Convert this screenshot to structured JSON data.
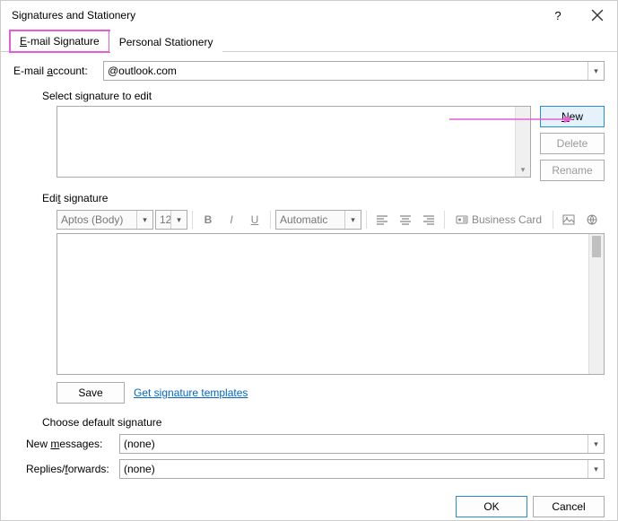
{
  "window": {
    "title": "Signatures and Stationery"
  },
  "tabs": {
    "email": "E-mail Signature",
    "stationery": "Personal Stationery"
  },
  "account": {
    "label": "E-mail account:",
    "value": "            @outlook.com"
  },
  "select_signature": {
    "label": "Select signature to edit"
  },
  "buttons": {
    "new": "New",
    "delete": "Delete",
    "rename": "Rename",
    "save": "Save",
    "ok": "OK",
    "cancel": "Cancel"
  },
  "edit": {
    "label": "Edit signature",
    "font": "Aptos (Body)",
    "size": "12",
    "color": "Automatic",
    "business_card": "Business Card"
  },
  "templates_link": "Get signature templates",
  "defaults": {
    "label": "Choose default signature",
    "new_messages": {
      "label": "New messages:",
      "value": "(none)"
    },
    "replies": {
      "label": "Replies/forwards:",
      "value": "(none)"
    }
  }
}
